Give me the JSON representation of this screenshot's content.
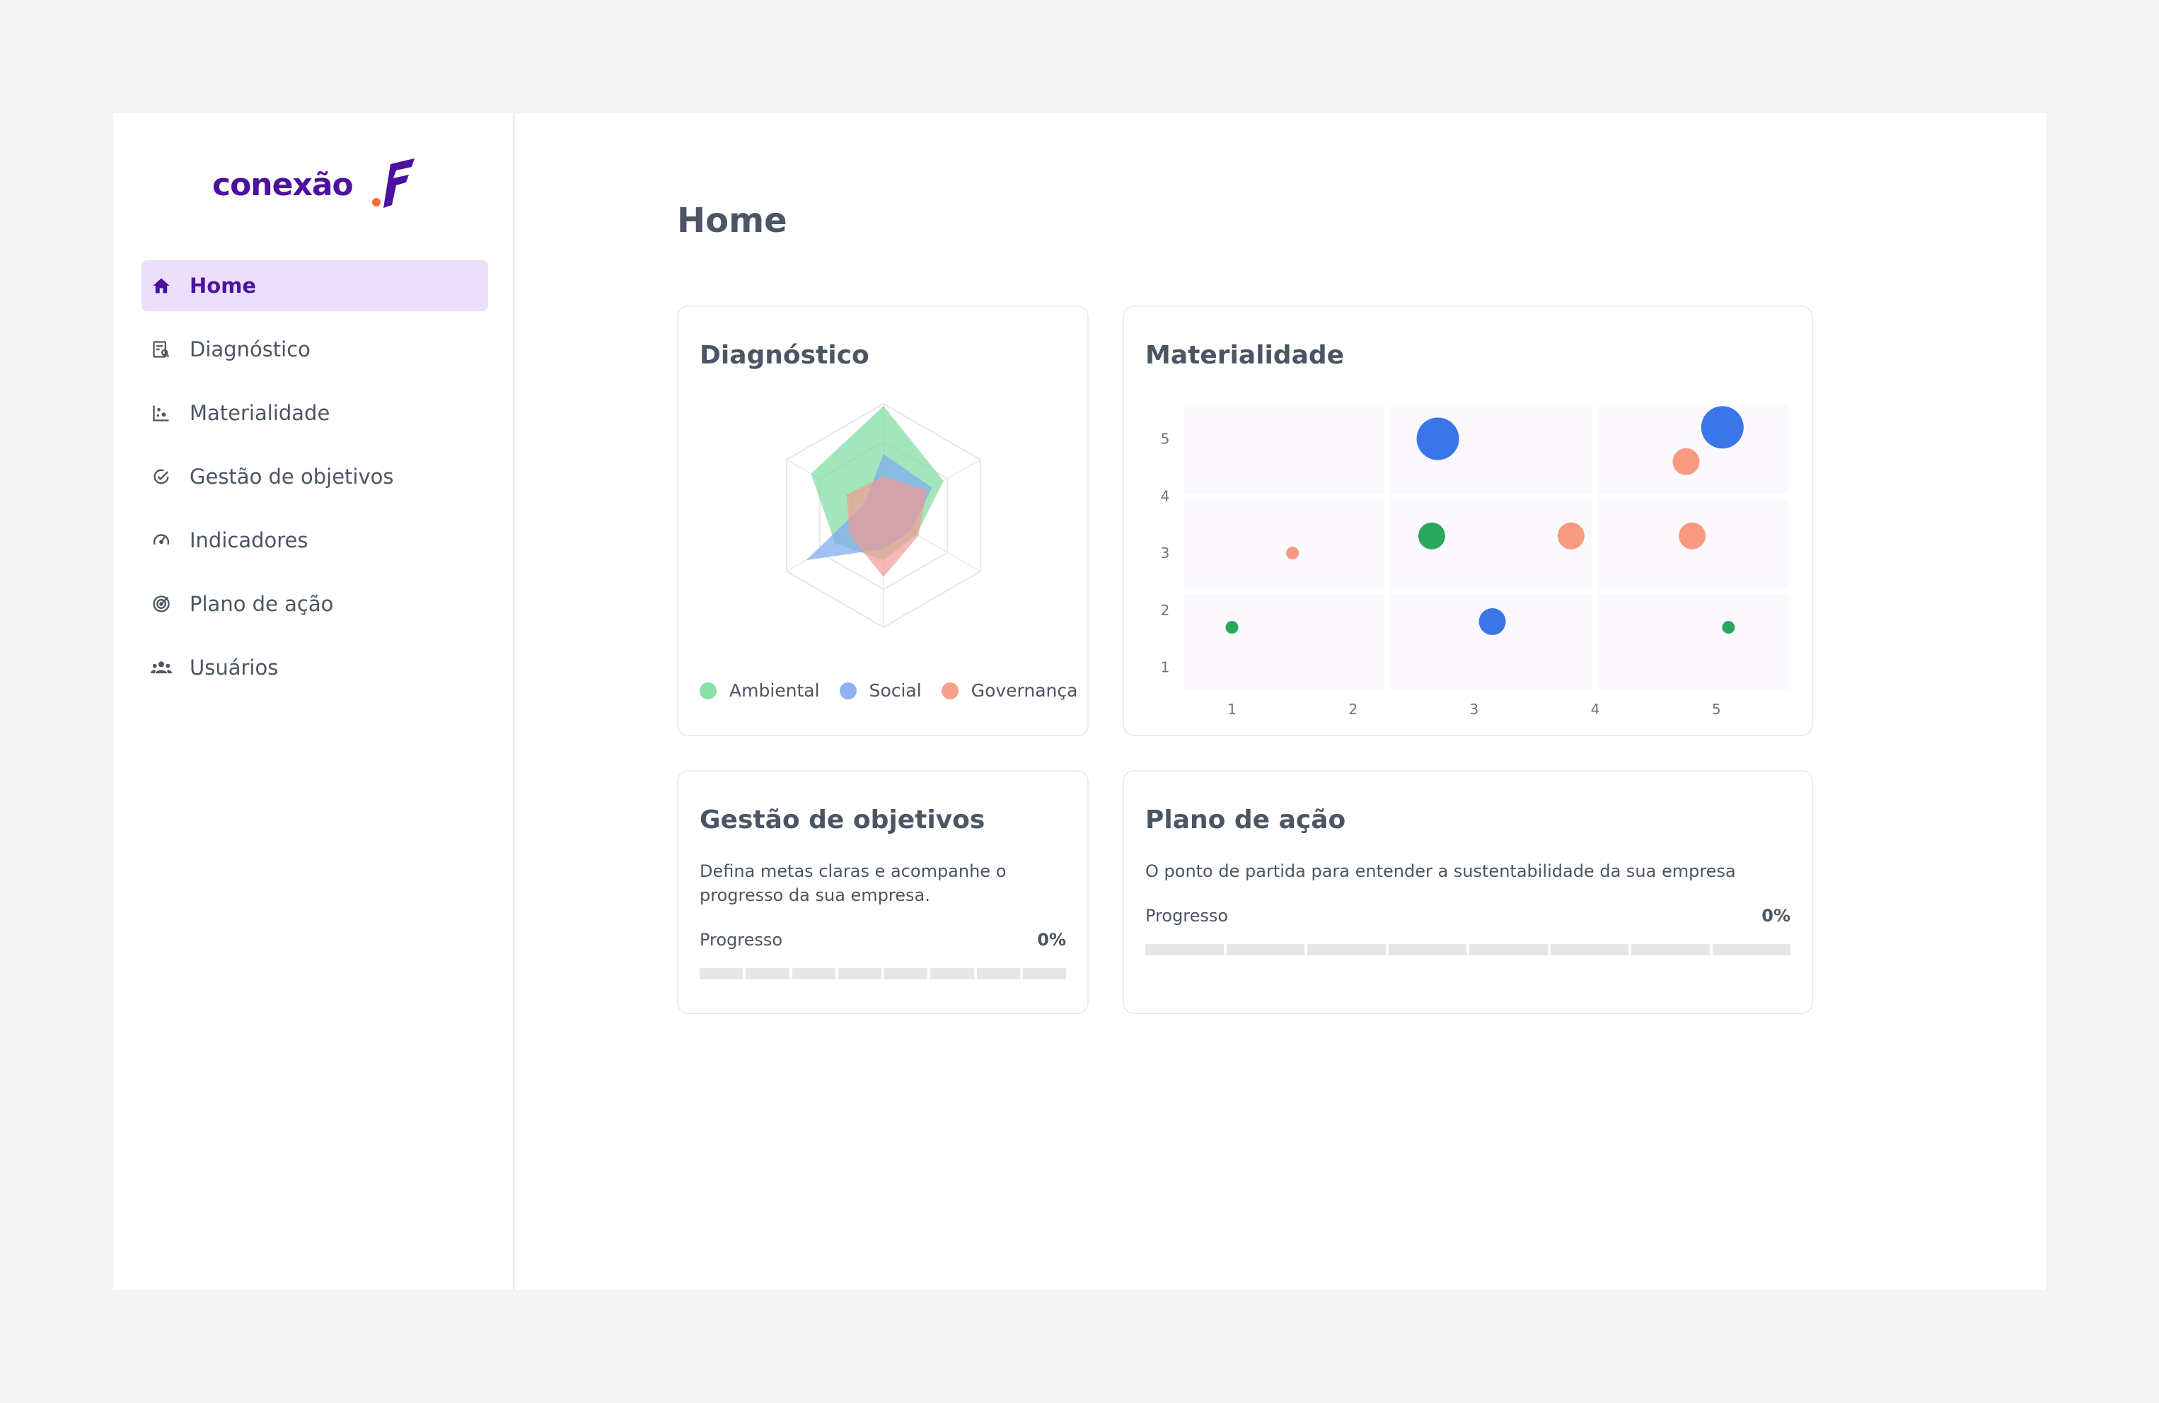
{
  "brand": {
    "logo_text": "conexão",
    "colors": {
      "primary": "#4c119e",
      "accent": "#ff6b3d",
      "active_bg": "#ebdffc"
    }
  },
  "sidebar": {
    "items": [
      {
        "label": "Home",
        "icon": "home-icon",
        "active": true
      },
      {
        "label": "Diagnóstico",
        "icon": "report-search-icon"
      },
      {
        "label": "Materialidade",
        "icon": "scatter-chart-icon"
      },
      {
        "label": "Gestão de objetivos",
        "icon": "check-circle-icon"
      },
      {
        "label": "Indicadores",
        "icon": "gauge-icon"
      },
      {
        "label": "Plano de ação",
        "icon": "target-icon"
      },
      {
        "label": "Usuários",
        "icon": "users-icon"
      }
    ]
  },
  "page": {
    "title": "Home"
  },
  "cards": {
    "diagnostico": {
      "title": "Diagnóstico",
      "legend": [
        {
          "label": "Ambiental",
          "color": "#86e0a8"
        },
        {
          "label": "Social",
          "color": "#8fb0f2"
        },
        {
          "label": "Governança",
          "color": "#f7a088"
        }
      ]
    },
    "materialidade": {
      "title": "Materialidade"
    },
    "gestao": {
      "title": "Gestão de objetivos",
      "description_line1": "Defina metas claras e acompanhe o",
      "description_line2": "progresso da sua empresa.",
      "progress_label": "Progresso",
      "progress_value": "0%",
      "progress": 0
    },
    "plano": {
      "title": "Plano de ação",
      "description": "O ponto de partida para entender a sustentabilidade da sua empresa",
      "progress_label": "Progresso",
      "progress_value": "0%",
      "progress": 0
    }
  },
  "chart_data": [
    {
      "type": "radar",
      "title": "Diagnóstico",
      "axes_count": 6,
      "max": 1,
      "series": [
        {
          "name": "Ambiental",
          "color": "#7ddc9f",
          "values": [
            0.98,
            0.62,
            0.34,
            0.4,
            0.5,
            0.75
          ]
        },
        {
          "name": "Social",
          "color": "#7ea6f0",
          "values": [
            0.55,
            0.5,
            0.28,
            0.3,
            0.8,
            0.2
          ]
        },
        {
          "name": "Governança",
          "color": "#f29a94",
          "values": [
            0.35,
            0.45,
            0.36,
            0.55,
            0.35,
            0.38
          ]
        }
      ]
    },
    {
      "type": "scatter",
      "title": "Materialidade",
      "x_ticks": [
        "1",
        "2",
        "3",
        "4",
        "5"
      ],
      "y_ticks": [
        "1",
        "2",
        "3",
        "4",
        "5"
      ],
      "xlim": [
        0.6,
        5.6
      ],
      "ylim": [
        0.6,
        5.6
      ],
      "points": [
        {
          "x": 2.7,
          "y": 5.0,
          "size": 3,
          "color": "#3b76e8"
        },
        {
          "x": 5.05,
          "y": 5.2,
          "size": 3,
          "color": "#3b76e8"
        },
        {
          "x": 4.75,
          "y": 4.6,
          "size": 2,
          "color": "#f79a80"
        },
        {
          "x": 1.5,
          "y": 3.0,
          "size": 1,
          "color": "#f79a80"
        },
        {
          "x": 2.65,
          "y": 3.3,
          "size": 2,
          "color": "#29a85d"
        },
        {
          "x": 3.8,
          "y": 3.3,
          "size": 2,
          "color": "#f79a80"
        },
        {
          "x": 4.8,
          "y": 3.3,
          "size": 2,
          "color": "#f79a80"
        },
        {
          "x": 1.0,
          "y": 1.7,
          "size": 1,
          "color": "#29a85d"
        },
        {
          "x": 3.15,
          "y": 1.8,
          "size": 2,
          "color": "#3b76e8"
        },
        {
          "x": 5.1,
          "y": 1.7,
          "size": 1,
          "color": "#29a85d"
        }
      ]
    }
  ]
}
